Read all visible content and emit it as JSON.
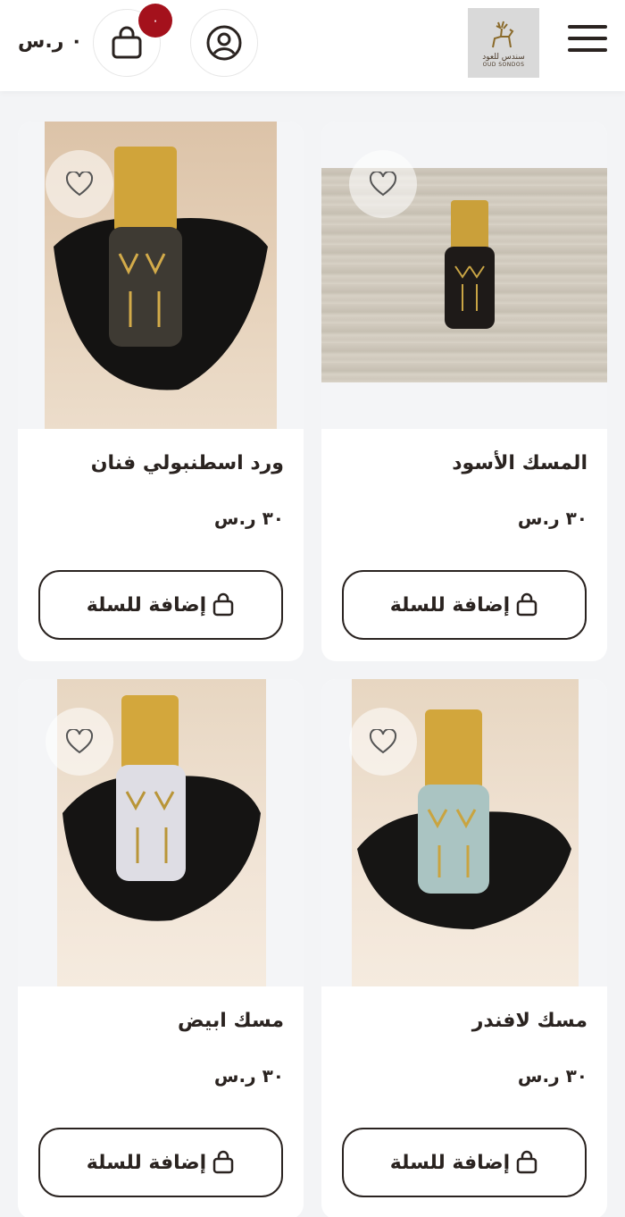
{
  "header": {
    "cart_total": "٠ ر.س",
    "cart_count": "٠",
    "logo_text_ar": "سندس للعود",
    "logo_text_en": "OUD SONDOS",
    "icons": [
      "menu-icon",
      "user-icon",
      "cart-bag-icon"
    ]
  },
  "products": [
    {
      "name": "المسك الأسود",
      "price": "٣٠ ر.س",
      "button": "إضافة للسلة"
    },
    {
      "name": "ورد اسطنبولي فنان",
      "price": "٣٠ ر.س",
      "button": "إضافة للسلة"
    },
    {
      "name": "مسك لافندر",
      "price": "٣٠ ر.س",
      "button": "إضافة للسلة"
    },
    {
      "name": "مسك ابيض",
      "price": "٣٠ ر.س",
      "button": "إضافة للسلة"
    }
  ],
  "colors": {
    "accent": "#a4111c",
    "text": "#2a2320",
    "gold": "#d4a62a"
  }
}
